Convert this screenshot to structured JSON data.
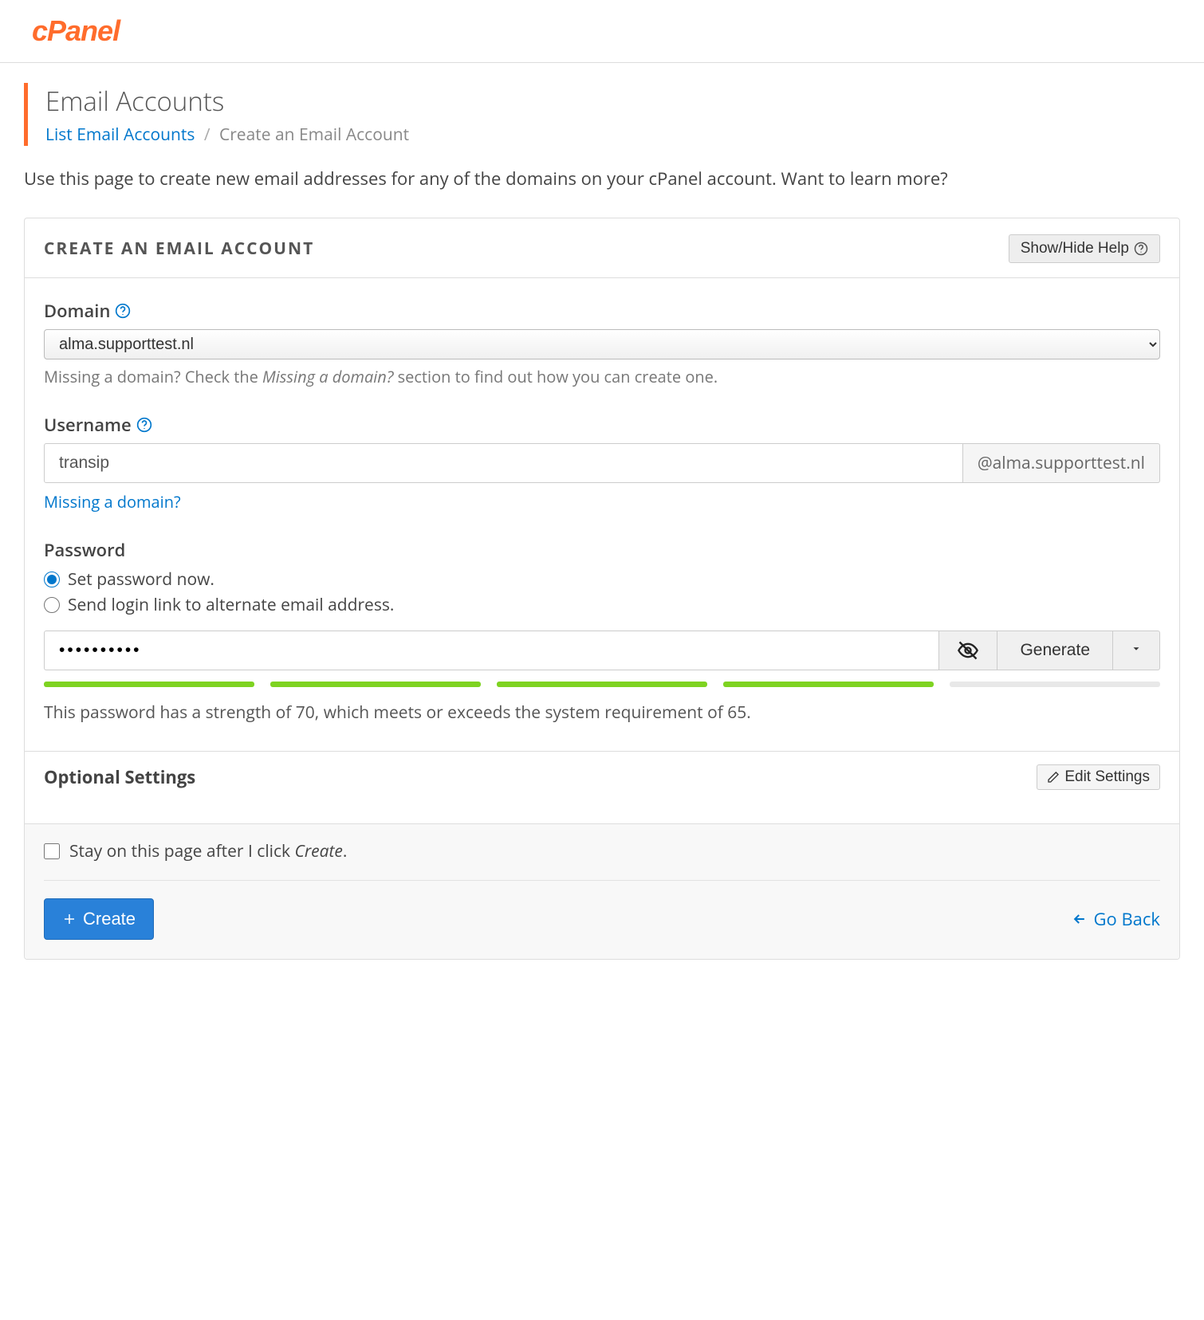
{
  "logo": "cPanel",
  "page_title": "Email Accounts",
  "breadcrumb": {
    "link_label": "List Email Accounts",
    "current": "Create an Email Account"
  },
  "intro_text": "Use this page to create new email addresses for any of the domains on your cPanel account. Want to learn more?",
  "panel": {
    "title": "CREATE AN EMAIL ACCOUNT",
    "help_button": "Show/Hide Help"
  },
  "domain": {
    "label": "Domain",
    "value": "alma.supporttest.nl",
    "hint_prefix": "Missing a domain? Check the ",
    "hint_em": "Missing a domain?",
    "hint_suffix": " section to find out how you can create one."
  },
  "username": {
    "label": "Username",
    "value": "transip",
    "addon": "@alma.supporttest.nl",
    "missing_link": "Missing a domain?"
  },
  "password": {
    "label": "Password",
    "opt_now": "Set password now.",
    "opt_link": "Send login link to alternate email address.",
    "value": "••••••••••",
    "generate_label": "Generate",
    "strength_segments": 5,
    "strength_filled": 4,
    "strength_text": "This password has a strength of 70, which meets or exceeds the system requirement of 65."
  },
  "optional": {
    "title": "Optional Settings",
    "edit_label": "Edit Settings"
  },
  "footer": {
    "stay_prefix": "Stay on this page after I click ",
    "stay_em": "Create",
    "create_label": "Create",
    "back_label": "Go Back"
  }
}
